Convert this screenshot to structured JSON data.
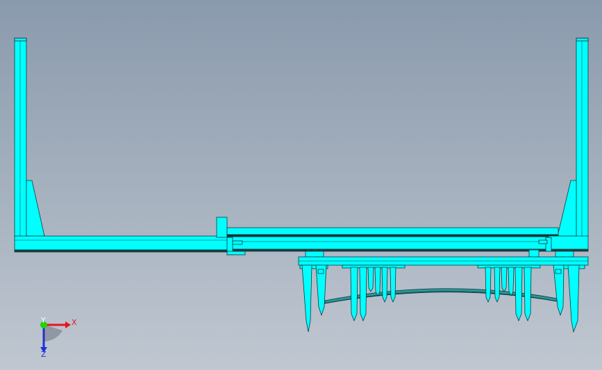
{
  "viewport": {
    "background_top": "#8a9aad",
    "background_bottom": "#c0c7d1"
  },
  "model": {
    "body_color": "#00ffff",
    "shadow_color": "#00b7bf",
    "edge_color": "#0a3b40",
    "rail_color": "#2b9696"
  },
  "triad": {
    "x_label": "X",
    "y_label": "Y",
    "z_label": "Z",
    "x_color": "#e8141c",
    "y_color": "#1fd400",
    "z_color": "#2030d8"
  }
}
